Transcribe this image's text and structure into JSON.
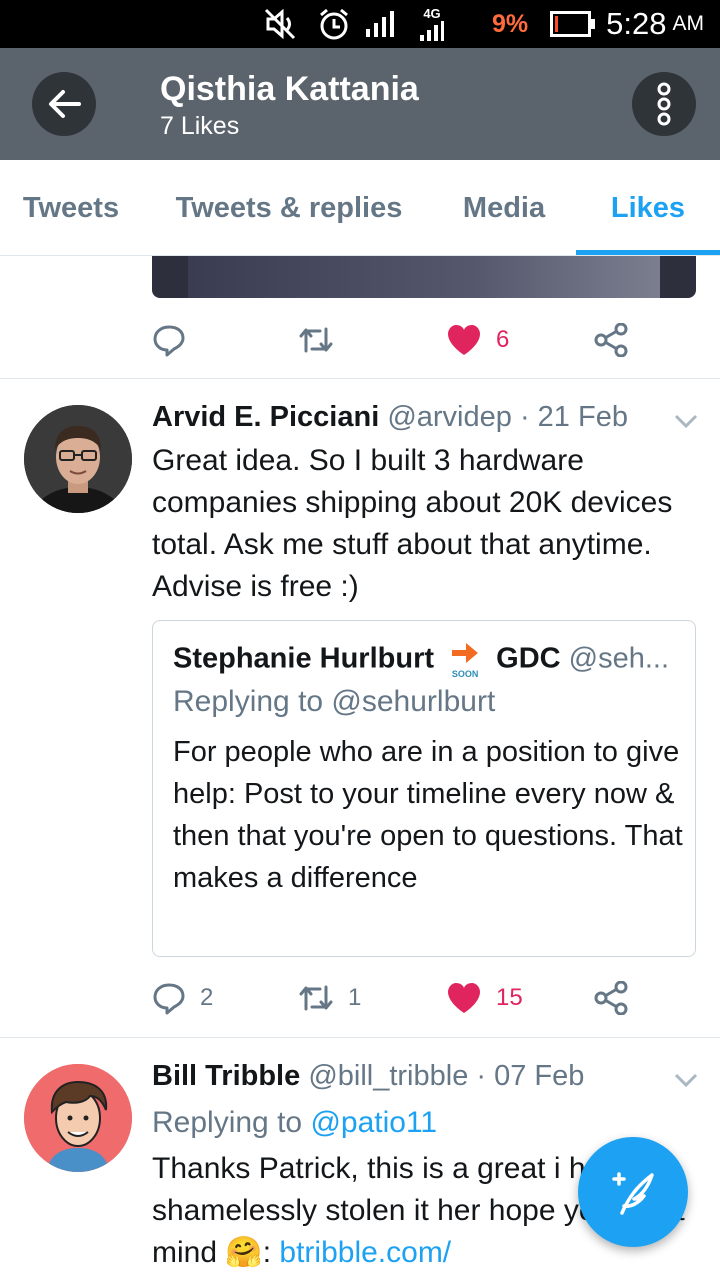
{
  "status_bar": {
    "network": "4G",
    "battery_percent": "9%",
    "time": "5:28",
    "ampm": "AM",
    "icons": [
      "mute-icon",
      "alarm-icon",
      "signal-icon",
      "signal-4g-icon",
      "battery-icon"
    ]
  },
  "header": {
    "title": "Qisthia Kattania",
    "subtitle": "7 Likes"
  },
  "tabs": [
    {
      "label": "Tweets",
      "active": false
    },
    {
      "label": "Tweets & replies",
      "active": false
    },
    {
      "label": "Media",
      "active": false
    },
    {
      "label": "Likes",
      "active": true
    }
  ],
  "tweets": [
    {
      "actions": {
        "reply_count": "",
        "retweet_count": "",
        "like_count": "6",
        "liked": true
      }
    },
    {
      "name": "Arvid E. Picciani",
      "handle": "@arvidep",
      "date": "· 21 Feb",
      "text": "Great idea. So I built 3 hardware companies shipping about 20K devices total. Ask me stuff about that anytime. Advise is free :)",
      "quote": {
        "name": "Stephanie Hurlburt",
        "soon_label": "SOON",
        "name_suffix": "GDC",
        "handle": "@seh...",
        "reply_to": "Replying to @sehurlburt",
        "text": "For people who are in a position to give help: Post to your timeline every now & then that you're open to questions. That makes a difference"
      },
      "actions": {
        "reply_count": "2",
        "retweet_count": "1",
        "like_count": "15",
        "liked": true
      }
    },
    {
      "name": "Bill Tribble",
      "handle": "@bill_tribble",
      "date": "· 07 Feb",
      "reply_prefix": "Replying to ",
      "reply_handle": "@patio11",
      "text": "Thanks Patrick, this is a great i have shamelessly stolen it her hope you don't mind",
      "emoji": "🤗",
      "link_prefix": ": ",
      "link": "btribble.com/"
    }
  ],
  "colors": {
    "accent": "#1da1f2",
    "like": "#e0245e",
    "header_bg": "#5b646c",
    "muted": "#657786"
  }
}
